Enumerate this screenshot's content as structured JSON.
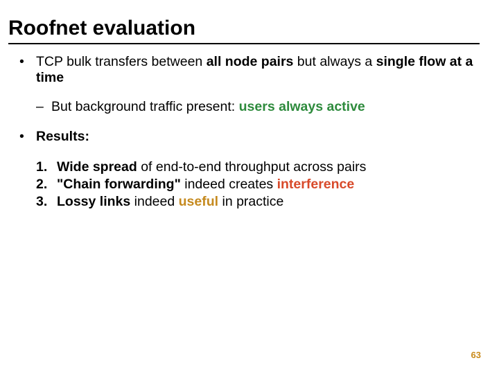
{
  "title": "Roofnet evaluation",
  "bullets": {
    "main1": {
      "pre": "TCP bulk transfers between ",
      "bold1": "all node pairs",
      "mid": " but always a ",
      "bold2": "single flow at a time"
    },
    "sub1": {
      "pre": "But background traffic present: ",
      "green": "users always active"
    },
    "main2": "Results:",
    "item1": {
      "bold": "Wide spread",
      "rest": " of end-to-end throughput across pairs"
    },
    "item2": {
      "bold": "\"Chain forwarding\"",
      "mid": " indeed creates ",
      "red": "interference"
    },
    "item3": {
      "bold": "Lossy links",
      "mid": " indeed ",
      "orange": "useful",
      "rest": " in practice"
    }
  },
  "markers": {
    "dot": "•",
    "dash": "–",
    "n1": "1.",
    "n2": "2.",
    "n3": "3."
  },
  "pagenum": "63"
}
